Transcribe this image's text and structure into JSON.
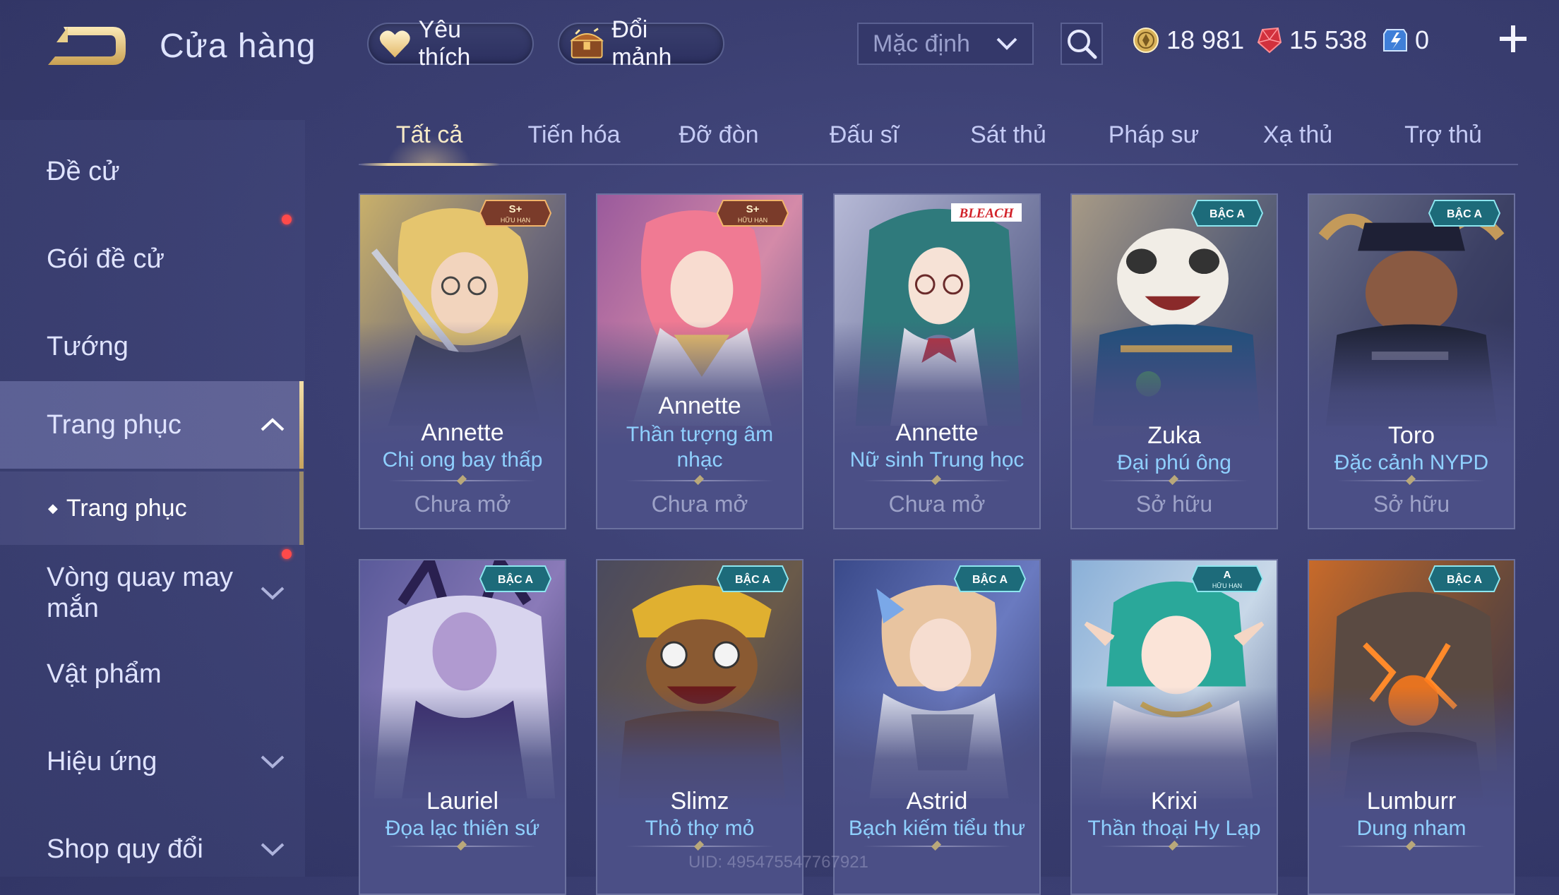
{
  "header": {
    "title": "Cửa hàng",
    "favorites_label": "Yêu thích",
    "exchange_label": "Đổi mảnh",
    "sort_value": "Mặc định",
    "currency": {
      "gold": "18 981",
      "ruby": "15 538",
      "voucher": "0"
    }
  },
  "sidebar": {
    "items": [
      {
        "label": "Đề cử"
      },
      {
        "label": "Gói đề cử"
      },
      {
        "label": "Tướng"
      },
      {
        "label": "Trang phục"
      },
      {
        "label": "Vòng quay may mắn"
      },
      {
        "label": "Vật phẩm"
      },
      {
        "label": "Hiệu ứng"
      },
      {
        "label": "Shop quy đổi"
      }
    ],
    "sub_item": "Trang phục"
  },
  "tabs": [
    "Tất cả",
    "Tiến hóa",
    "Đỡ đòn",
    "Đấu sĩ",
    "Sát thủ",
    "Pháp sư",
    "Xạ thủ",
    "Trợ thủ"
  ],
  "cards": [
    {
      "hero": "Annette",
      "skin": "Chị ong bay thấp",
      "status": "Chưa mở",
      "badge": "S+",
      "badge_sub": "HỮU HẠN"
    },
    {
      "hero": "Annette",
      "skin": "Thần tượng âm nhạc",
      "status": "Chưa mở",
      "badge": "S+",
      "badge_sub": "HỮU HẠN"
    },
    {
      "hero": "Annette",
      "skin": "Nữ sinh Trung học",
      "status": "Chưa mở",
      "badge": "BLEACH",
      "badge_sub": ""
    },
    {
      "hero": "Zuka",
      "skin": "Đại phú ông",
      "status": "Sở hữu",
      "badge": "BẬC A",
      "badge_sub": ""
    },
    {
      "hero": "Toro",
      "skin": "Đặc cảnh NYPD",
      "status": "Sở hữu",
      "badge": "BẬC A",
      "badge_sub": ""
    },
    {
      "hero": "Lauriel",
      "skin": "Đọa lạc thiên sứ",
      "status": "",
      "badge": "BẬC A",
      "badge_sub": ""
    },
    {
      "hero": "Slimz",
      "skin": "Thỏ thợ mỏ",
      "status": "",
      "badge": "BẬC A",
      "badge_sub": ""
    },
    {
      "hero": "Astrid",
      "skin": "Bạch kiếm tiểu thư",
      "status": "",
      "badge": "BẬC A",
      "badge_sub": ""
    },
    {
      "hero": "Krixi",
      "skin": "Thần thoại Hy Lạp",
      "status": "",
      "badge": "A",
      "badge_sub": "HỮU HẠN"
    },
    {
      "hero": "Lumburr",
      "skin": "Dung nham",
      "status": "",
      "badge": "BẬC A",
      "badge_sub": ""
    }
  ],
  "uid": "UID: 4954755477679​21",
  "colors": {
    "accent_gold": "#f0d798",
    "skin_name_blue": "#8fd0ff",
    "notification_red": "#ff4a4a"
  }
}
